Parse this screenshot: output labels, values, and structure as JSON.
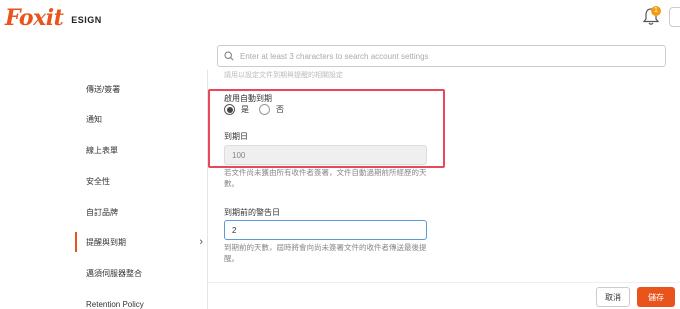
{
  "header": {
    "logo_main": "Foxit",
    "logo_sub": "ESIGN",
    "notification_count": "1"
  },
  "search": {
    "placeholder": "Enter at least 3 characters to search account settings"
  },
  "sidebar": {
    "items": [
      {
        "label": "傳送/簽署"
      },
      {
        "label": "通知"
      },
      {
        "label": "線上表單"
      },
      {
        "label": "安全性"
      },
      {
        "label": "自訂品牌"
      },
      {
        "label": "提醒與到期"
      },
      {
        "label": "邁須伺服器整合"
      },
      {
        "label": "Retention Policy"
      }
    ]
  },
  "main": {
    "top_cut_text": "請用以設定文件到期與提醒的相關設定",
    "auto_expire_label": "啟用自動到期",
    "radio_yes": "是",
    "radio_no": "否",
    "expiry_days_label": "到期日",
    "expiry_days_value": "100",
    "expiry_help": "若文件尚未獲由所有收件者簽署，文件自動過期前所經歷的天數。",
    "warning_label": "到期前的警告日",
    "warning_value": "2",
    "warning_help": "到期前的天數，屆時將會向尚未簽署文件的收件者傳送最後提醒。"
  },
  "footer": {
    "cancel_label": "取消",
    "save_label": "儲存"
  },
  "colors": {
    "brand": "#e8541c",
    "highlight": "#e8495a",
    "focus": "#5b9bd5"
  }
}
